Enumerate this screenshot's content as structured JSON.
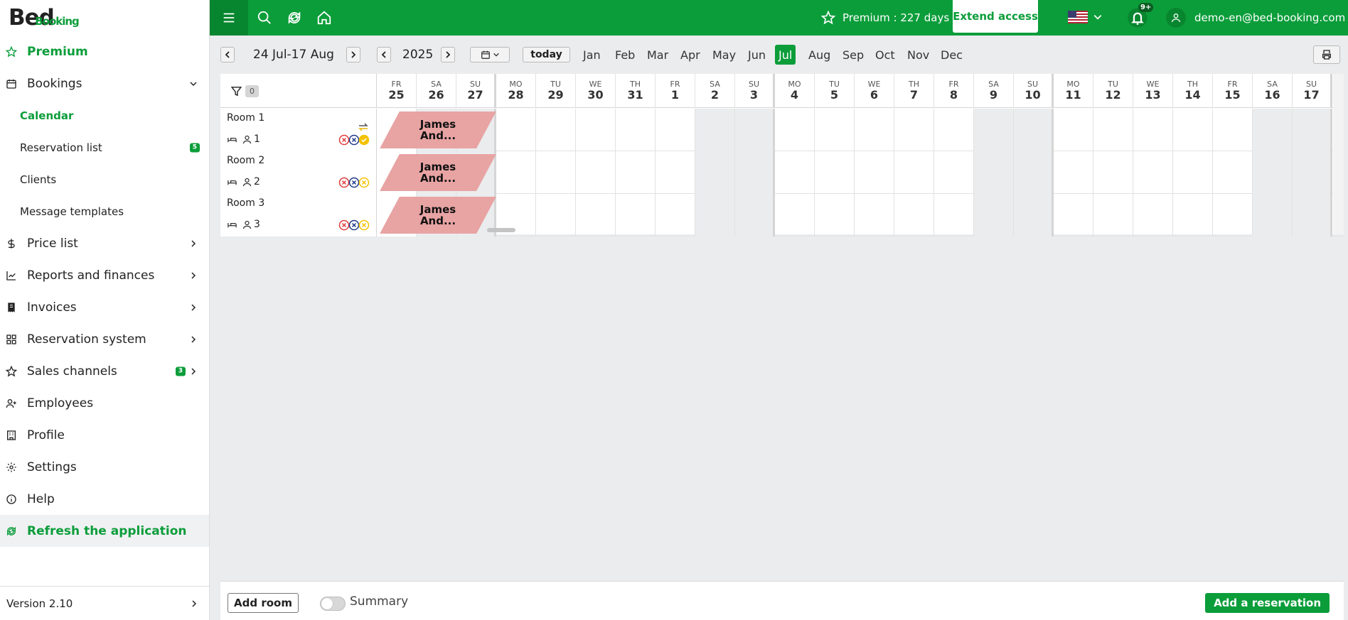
{
  "logo": {
    "part1": "Bed",
    "part2": "Booking"
  },
  "sidebar": {
    "premium": "Premium",
    "bookings": "Bookings",
    "bookings_sub": [
      {
        "label": "Calendar",
        "active": true
      },
      {
        "label": "Reservation list",
        "badge": "5"
      },
      {
        "label": "Clients"
      },
      {
        "label": "Message templates"
      }
    ],
    "items": [
      {
        "label": "Price list"
      },
      {
        "label": "Reports and finances"
      },
      {
        "label": "Invoices"
      },
      {
        "label": "Reservation system"
      },
      {
        "label": "Sales channels",
        "badge": "3"
      },
      {
        "label": "Employees"
      },
      {
        "label": "Profile"
      },
      {
        "label": "Settings"
      },
      {
        "label": "Help"
      }
    ],
    "refresh": "Refresh the application",
    "version": "Version 2.10"
  },
  "topbar": {
    "premium_text": "Premium : 227 days",
    "extend": "Extend access",
    "notifications": "9+",
    "user": "demo-en@bed-booking.com"
  },
  "toolbar": {
    "range": "24 Jul-17 Aug",
    "year": "2025",
    "today": "today",
    "months": [
      "Jan",
      "Feb",
      "Mar",
      "Apr",
      "May",
      "Jun",
      "Jul",
      "Aug",
      "Sep",
      "Oct",
      "Nov",
      "Dec"
    ],
    "active_month": "Jul"
  },
  "calendar": {
    "filter_count": "0",
    "days": [
      {
        "dow": "FR",
        "num": "25"
      },
      {
        "dow": "SA",
        "num": "26"
      },
      {
        "dow": "SU",
        "num": "27"
      },
      {
        "dow": "MO",
        "num": "28"
      },
      {
        "dow": "TU",
        "num": "29"
      },
      {
        "dow": "WE",
        "num": "30"
      },
      {
        "dow": "TH",
        "num": "31"
      },
      {
        "dow": "FR",
        "num": "1"
      },
      {
        "dow": "SA",
        "num": "2"
      },
      {
        "dow": "SU",
        "num": "3"
      },
      {
        "dow": "MO",
        "num": "4"
      },
      {
        "dow": "TU",
        "num": "5"
      },
      {
        "dow": "WE",
        "num": "6"
      },
      {
        "dow": "TH",
        "num": "7"
      },
      {
        "dow": "FR",
        "num": "8"
      },
      {
        "dow": "SA",
        "num": "9"
      },
      {
        "dow": "SU",
        "num": "10"
      },
      {
        "dow": "MO",
        "num": "11"
      },
      {
        "dow": "TU",
        "num": "12"
      },
      {
        "dow": "WE",
        "num": "13"
      },
      {
        "dow": "TH",
        "num": "14"
      },
      {
        "dow": "FR",
        "num": "15"
      },
      {
        "dow": "SA",
        "num": "16"
      },
      {
        "dow": "SU",
        "num": "17"
      }
    ],
    "rooms": [
      {
        "name": "Room 1",
        "capacity": "1",
        "booking": "James And...",
        "swap": true
      },
      {
        "name": "Room 2",
        "capacity": "2",
        "booking": "James And..."
      },
      {
        "name": "Room 3",
        "capacity": "3",
        "booking": "James And..."
      }
    ]
  },
  "bottombar": {
    "add_room": "Add room",
    "summary": "Summary",
    "add_reservation": "Add a reservation"
  }
}
